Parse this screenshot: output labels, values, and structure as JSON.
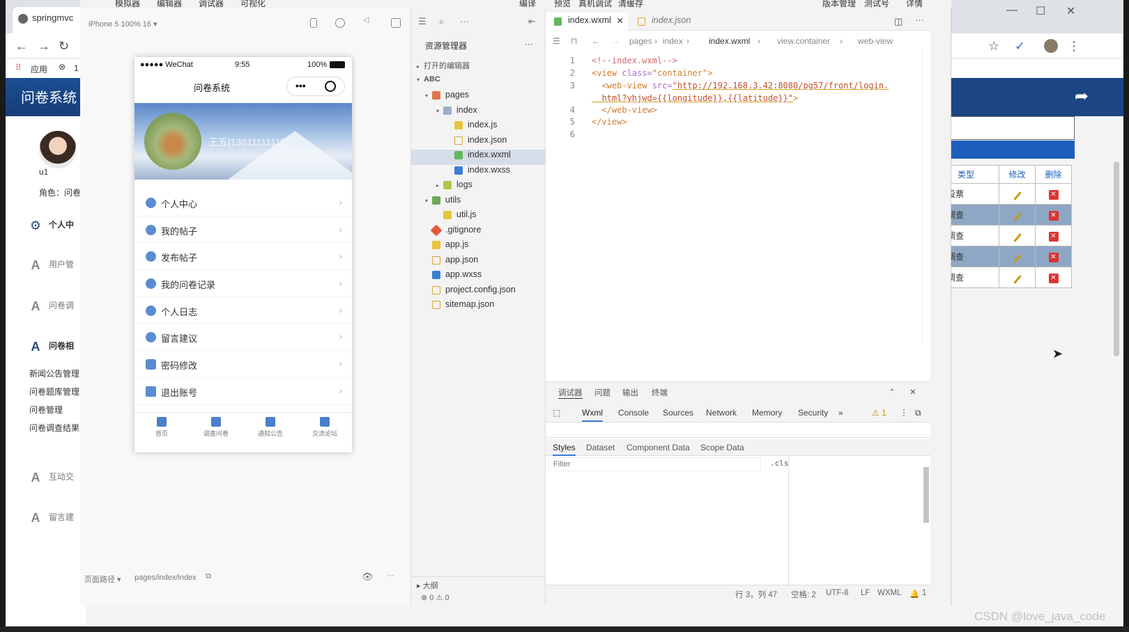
{
  "browser": {
    "tab_title": "springmvc",
    "bookmarks_apps": "应用",
    "bookmarks_more": "1"
  },
  "left_sidebar": {
    "title": "问卷系统",
    "username": "u1",
    "role": "角色：问卷",
    "items": [
      {
        "label": "个人中",
        "icon": "gear-icon"
      },
      {
        "label": "用户管",
        "icon": "a-icon"
      },
      {
        "label": "问卷调",
        "icon": "a-icon"
      },
      {
        "label": "问卷相",
        "icon": "a-icon"
      },
      {
        "label": "新闻公告管理",
        "icon": ""
      },
      {
        "label": "问卷题库管理",
        "icon": ""
      },
      {
        "label": "问卷管理",
        "icon": ""
      },
      {
        "label": "问卷调查结果",
        "icon": ""
      },
      {
        "label": "互动交",
        "icon": "a-icon"
      },
      {
        "label": "留言建",
        "icon": "a-icon"
      }
    ]
  },
  "right_table": {
    "headers": [
      "类型",
      "修改",
      "删除"
    ],
    "rows": [
      "投票",
      "调查",
      "调查",
      "调查",
      "调查"
    ]
  },
  "devtools": {
    "menu": [
      "模拟器",
      "编辑器",
      "调试器",
      "可视化",
      "编译",
      "预览",
      "真机调试",
      "清缓存",
      "版本管理",
      "测试号",
      "详情"
    ],
    "simulator": {
      "device": "iPhone 5 100% 16 ▾",
      "status_left": "●●●●● WeChat",
      "status_time": "9:55",
      "status_battery": "100%",
      "nav_title": "问卷系统",
      "user_name": "王五[13811111111]",
      "menu_items": [
        "个人中心",
        "我的帖子",
        "发布帖子",
        "我的问卷记录",
        "个人日志",
        "留言建议",
        "密码修改",
        "退出账号"
      ],
      "tabs": [
        "首页",
        "调查问卷",
        "通知公告",
        "交流论坛"
      ],
      "path_label": "页面路径 ▾",
      "path_value": "pages/index/index"
    },
    "explorer": {
      "title": "资源管理器",
      "open_editors": "打开的编辑器",
      "project": "ABC",
      "items": [
        {
          "label": "pages",
          "kind": "folder"
        },
        {
          "label": "index",
          "kind": "folder"
        },
        {
          "label": "index.js",
          "kind": "js"
        },
        {
          "label": "index.json",
          "kind": "json"
        },
        {
          "label": "index.wxml",
          "kind": "wxml"
        },
        {
          "label": "index.wxss",
          "kind": "wxss"
        },
        {
          "label": "logs",
          "kind": "folder"
        },
        {
          "label": "utils",
          "kind": "folder"
        },
        {
          "label": "util.js",
          "kind": "js"
        },
        {
          "label": ".gitignore",
          "kind": "git"
        },
        {
          "label": "app.js",
          "kind": "js"
        },
        {
          "label": "app.json",
          "kind": "json"
        },
        {
          "label": "app.wxss",
          "kind": "wxss"
        },
        {
          "label": "project.config.json",
          "kind": "json"
        },
        {
          "label": "sitemap.json",
          "kind": "json"
        }
      ],
      "outline": "大纲",
      "problems": "⊗ 0 ⚠ 0"
    },
    "editor": {
      "tabs": [
        "index.wxml",
        "index.json"
      ],
      "breadcrumb": [
        "pages",
        "index",
        "index.wxml",
        "view.container",
        "web-view"
      ],
      "lines": [
        {
          "n": "1",
          "html_parts": [
            [
              "cm",
              "<!--index.wxml-->"
            ]
          ]
        },
        {
          "n": "2",
          "html_parts": [
            [
              "tg",
              "<view "
            ],
            [
              "at",
              "class="
            ],
            [
              "tg",
              "\"container\">"
            ]
          ]
        },
        {
          "n": "3",
          "html_parts": [
            [
              "tg",
              "  <web-view "
            ],
            [
              "at",
              "src="
            ],
            [
              "st",
              "\"http://192.168.3.42:8080/pg57/front/login."
            ]
          ]
        },
        {
          "n": "",
          "html_parts": [
            [
              "st",
              "  html?yhjwd={{longitude}},{{latitude}}\""
            ],
            [
              "tg",
              ">"
            ]
          ]
        },
        {
          "n": "4",
          "html_parts": [
            [
              "tg",
              "  </web-view>"
            ]
          ]
        },
        {
          "n": "5",
          "html_parts": [
            [
              "tg",
              "</view>"
            ]
          ]
        },
        {
          "n": "6",
          "html_parts": [
            [
              "tg",
              ""
            ]
          ]
        }
      ]
    },
    "debug": {
      "tabs_top": [
        "调试器",
        "问题",
        "输出",
        "终端"
      ],
      "tabs": [
        "Wxml",
        "Console",
        "Sources",
        "Network",
        "Memory",
        "Security",
        "»"
      ],
      "warnings": "⚠ 1",
      "sub_tabs": [
        "Styles",
        "Dataset",
        "Component Data",
        "Scope Data"
      ],
      "filter_placeholder": "Filter",
      "cls": ".cls"
    },
    "status": {
      "position": "行 3，列 47",
      "spaces": "空格: 2",
      "encoding": "UTF-8",
      "eol": "LF",
      "language": "WXML",
      "bell": "1"
    }
  },
  "watermark": "CSDN @love_java_code"
}
